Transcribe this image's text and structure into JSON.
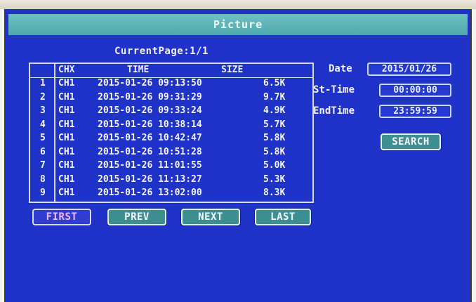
{
  "window": {
    "title": "Picture"
  },
  "current_page": "CurrentPage:1/1",
  "table": {
    "headers": [
      "CHX",
      "TIME",
      "SIZE"
    ],
    "rows": [
      {
        "num": "1",
        "ch": "CH1",
        "time": "2015-01-26 09:13:50",
        "size": "6.5K"
      },
      {
        "num": "2",
        "ch": "CH1",
        "time": "2015-01-26 09:31:29",
        "size": "9.7K"
      },
      {
        "num": "3",
        "ch": "CH1",
        "time": "2015-01-26 09:33:24",
        "size": "4.9K"
      },
      {
        "num": "4",
        "ch": "CH1",
        "time": "2015-01-26 10:38:14",
        "size": "5.7K"
      },
      {
        "num": "5",
        "ch": "CH1",
        "time": "2015-01-26 10:42:47",
        "size": "5.8K"
      },
      {
        "num": "6",
        "ch": "CH1",
        "time": "2015-01-26 10:51:28",
        "size": "5.8K"
      },
      {
        "num": "7",
        "ch": "CH1",
        "time": "2015-01-26 11:01:55",
        "size": "5.0K"
      },
      {
        "num": "8",
        "ch": "CH1",
        "time": "2015-01-26 11:13:27",
        "size": "5.3K"
      },
      {
        "num": "9",
        "ch": "CH1",
        "time": "2015-01-26 13:02:00",
        "size": "8.3K"
      }
    ]
  },
  "search": {
    "date_label": "Date",
    "date_value": "2015/01/26",
    "start_label": "St-Time",
    "start_value": "00:00:00",
    "end_label": "EndTime",
    "end_value": "23:59:59",
    "search_button": "SEARCH"
  },
  "pager": {
    "first": "FIRST",
    "prev": "PREV",
    "next": "NEXT",
    "last": "LAST"
  },
  "colors": {
    "background": "#1f33c8",
    "titlebar": "#5bb3b5",
    "button": "#3d8f91",
    "active_button_text": "#ffb4ff"
  }
}
